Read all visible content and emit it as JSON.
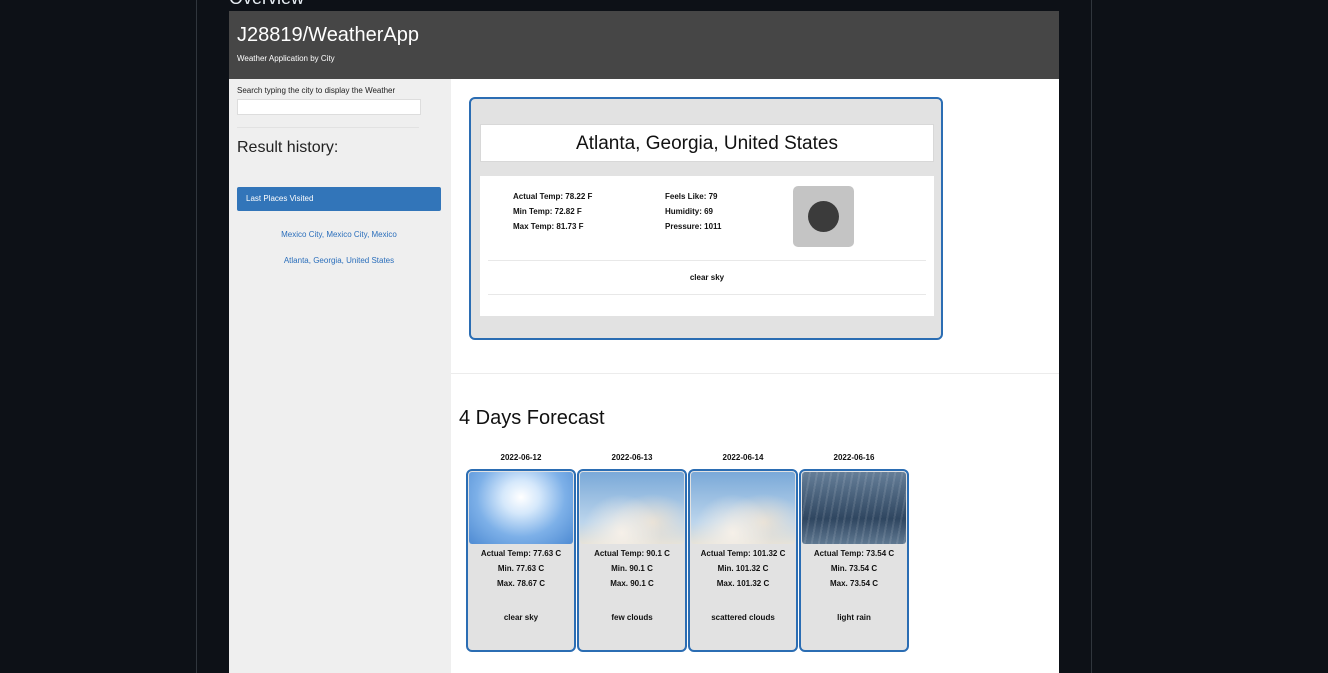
{
  "page": {
    "section_heading": "Overview"
  },
  "header": {
    "title": "J28819/WeatherApp",
    "subtitle": "Weather Application by City"
  },
  "sidebar": {
    "search_label": "Search typing the city to display the Weather",
    "search_value": "",
    "history_title": "Result history:",
    "last_places_label": "Last Places Visited",
    "history_items": [
      "Mexico City, Mexico City, Mexico",
      "Atlanta, Georgia, United States"
    ]
  },
  "current": {
    "city": "Atlanta, Georgia, United States",
    "actual_temp": "Actual Temp: 78.22 F",
    "min_temp": "Min Temp: 72.82 F",
    "max_temp": "Max Temp: 81.73 F",
    "feels_like": "Feels Like: 79",
    "humidity": "Humidity: 69",
    "pressure": "Pressure: 1011",
    "description": "clear sky",
    "icon": "moon-icon"
  },
  "forecast": {
    "title": "4 Days Forecast",
    "days": [
      {
        "date": "2022-06-12",
        "actual": "Actual Temp: 77.63 C",
        "min": "Min. 77.63 C",
        "max": "Max. 78.67 C",
        "desc": "clear sky",
        "image": "clear-sky-image"
      },
      {
        "date": "2022-06-13",
        "actual": "Actual Temp: 90.1 C",
        "min": "Min. 90.1 C",
        "max": "Max. 90.1 C",
        "desc": "few clouds",
        "image": "few-clouds-image"
      },
      {
        "date": "2022-06-14",
        "actual": "Actual Temp: 101.32 C",
        "min": "Min. 101.32 C",
        "max": "Max. 101.32 C",
        "desc": "scattered clouds",
        "image": "scattered-clouds-image"
      },
      {
        "date": "2022-06-16",
        "actual": "Actual Temp: 73.54 C",
        "min": "Min. 73.54 C",
        "max": "Max. 73.54 C",
        "desc": "light rain",
        "image": "light-rain-image"
      }
    ]
  },
  "colors": {
    "accent": "#2b6db3",
    "header_bg": "#464646",
    "sidebar_bg": "#efefef",
    "active_item": "#3275b9",
    "page_bg": "#0d1117"
  }
}
